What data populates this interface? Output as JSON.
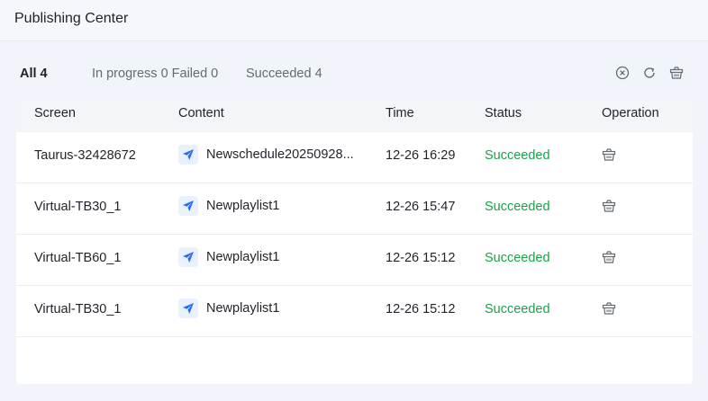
{
  "header": {
    "title": "Publishing Center"
  },
  "filters": {
    "all": "All 4",
    "in_progress_failed": "In progress 0 Failed 0",
    "succeeded": "Succeeded 4"
  },
  "toolbar": {
    "icons": [
      "clear-icon",
      "refresh-icon",
      "delete-icon"
    ]
  },
  "table": {
    "columns": [
      "Screen",
      "Content",
      "Time",
      "Status",
      "Operation"
    ],
    "rows": [
      {
        "screen": "Taurus-32428672",
        "content": "Newschedule20250928...",
        "time": "12-26 16:29",
        "status": "Succeeded"
      },
      {
        "screen": "Virtual-TB30_1",
        "content": "Newplaylist1",
        "time": "12-26 15:47",
        "status": "Succeeded"
      },
      {
        "screen": "Virtual-TB60_1",
        "content": "Newplaylist1",
        "time": "12-26 15:12",
        "status": "Succeeded"
      },
      {
        "screen": "Virtual-TB30_1",
        "content": "Newplaylist1",
        "time": "12-26 15:12",
        "status": "Succeeded"
      }
    ]
  },
  "colors": {
    "success": "#1aa34a",
    "accent": "#1f6ff2"
  }
}
